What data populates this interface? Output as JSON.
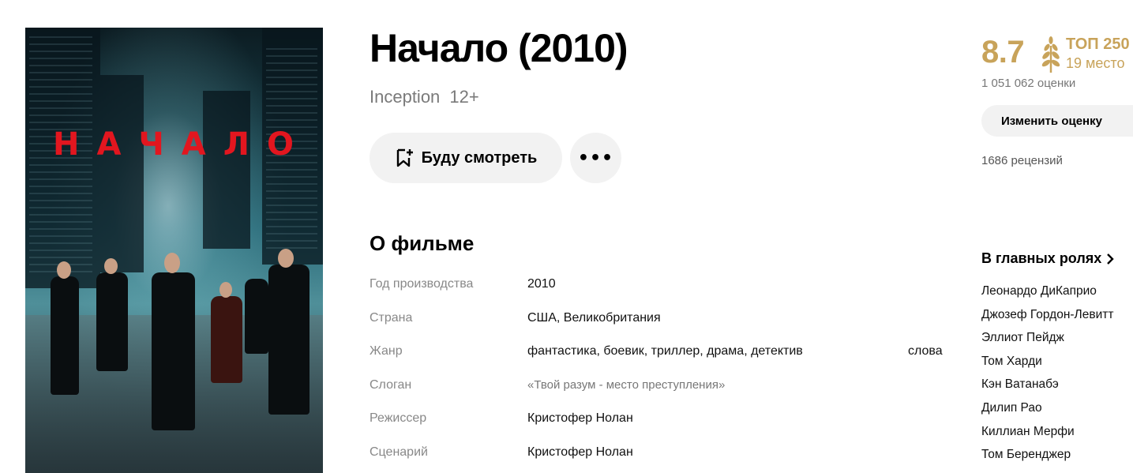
{
  "movie": {
    "title": "Начало (2010)",
    "original_title": "Inception",
    "age_rating": "12+",
    "poster_title": "НАЧАЛО"
  },
  "actions": {
    "watch_later_label": "Буду смотреть",
    "more_label": "•••"
  },
  "about": {
    "section_title": "О фильме",
    "facts": [
      {
        "label": "Год производства",
        "value": "2010"
      },
      {
        "label": "Страна",
        "value": "США, Великобритания"
      },
      {
        "label": "Жанр",
        "value": "фантастика, боевик, триллер, драма, детектив",
        "extra": "слова"
      },
      {
        "label": "Слоган",
        "value": "«Твой разум - место преступления»"
      },
      {
        "label": "Режиссер",
        "value": "Кристофер Нолан"
      },
      {
        "label": "Сценарий",
        "value": "Кристофер Нолан"
      }
    ]
  },
  "rating": {
    "score": "8.7",
    "top_label": "ТОП 250",
    "top_place": "19 место",
    "votes": "1 051 062 оценки",
    "change_button": "Изменить оценку",
    "reviews": "1686 рецензий",
    "accent_color": "#c8a35a"
  },
  "cast": {
    "title": "В главных ролях",
    "actors": [
      "Леонардо ДиКаприо",
      "Джозеф Гордон-Левитт",
      "Эллиот Пейдж",
      "Том Харди",
      "Кэн Ватанабэ",
      "Дилип Рао",
      "Киллиан Мерфи",
      "Том Беренджер"
    ]
  }
}
